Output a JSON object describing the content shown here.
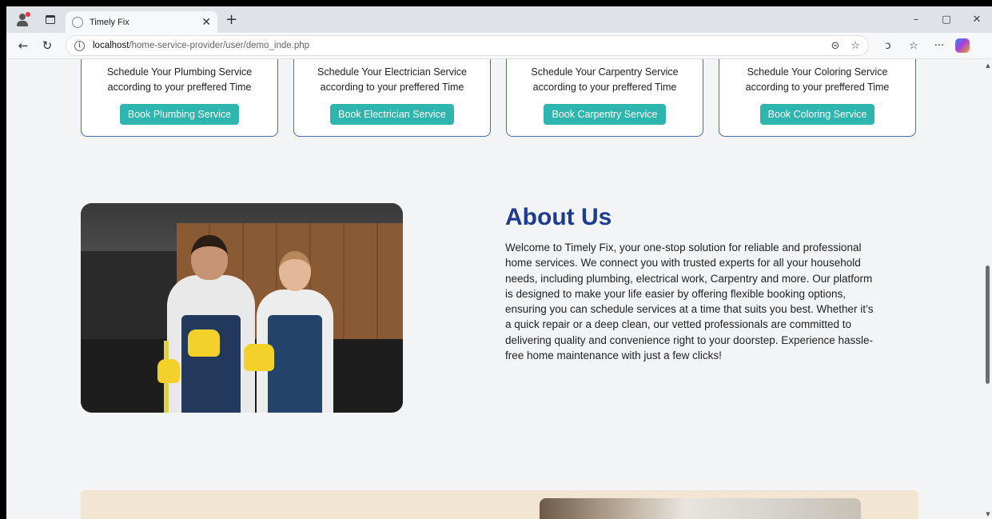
{
  "browser": {
    "tab_title": "Timely Fix",
    "new_tab": "+",
    "url_host": "localhost",
    "url_path": "/home-service-provider/user/demo_inde.php",
    "win_min": "–",
    "win_max": "▢",
    "win_close": "✕",
    "tab_close": "✕"
  },
  "services": [
    {
      "line1": "Schedule Your Plumbing Service",
      "line2": "according to your preffered Time",
      "button": "Book Plumbing Service"
    },
    {
      "line1": "Schedule Your Electrician Service",
      "line2": "according to your preffered Time",
      "button": "Book Electrician Service"
    },
    {
      "line1": "Schedule Your Carpentry Service",
      "line2": "according to your preffered Time",
      "button": "Book Carpentry Service"
    },
    {
      "line1": "Schedule Your Coloring Service",
      "line2": "according to your preffered Time",
      "button": "Book Coloring Service"
    }
  ],
  "about": {
    "title": "About Us",
    "text": "Welcome to Timely Fix, your one-stop solution for reliable and professional home services. We connect you with trusted experts for all your household needs, including plumbing, electrical work, Carpentry and more. Our platform is designed to make your life easier by offering flexible booking options, ensuring you can schedule services at a time that suits you best. Whether it’s a quick repair or a deep clean, our vetted professionals are committed to delivering quality and convenience right to your doorstep. Experience hassle-free home maintenance with just a few clicks!"
  },
  "colors": {
    "accent": "#2fb5b0",
    "heading": "#1e3c8f",
    "card_border": "#4a6bb5"
  }
}
